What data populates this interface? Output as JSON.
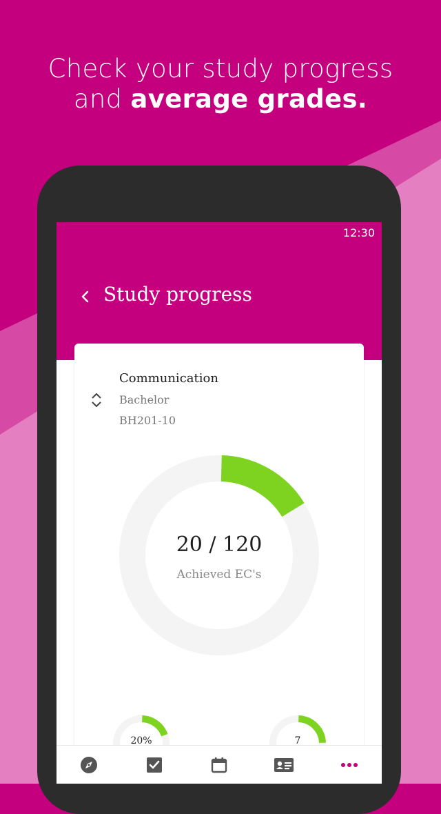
{
  "headline": {
    "line1": "Check your study progress",
    "line2_prefix": "and ",
    "line2_bold": "average grades."
  },
  "status_bar": {
    "time": "12:30"
  },
  "app_bar": {
    "title": "Study progress"
  },
  "program": {
    "name": "Communication",
    "level": "Bachelor",
    "code": "BH201-10"
  },
  "progress": {
    "value_text": "20 / 120",
    "label": "Achieved EC's",
    "fraction": 0.1667
  },
  "mini_stats": [
    {
      "text": "20%",
      "fraction": 0.2
    },
    {
      "text": "7",
      "fraction": 0.25
    }
  ],
  "bottom_nav": [
    {
      "icon": "compass-icon"
    },
    {
      "icon": "checkbox-icon"
    },
    {
      "icon": "calendar-icon"
    },
    {
      "icon": "id-card-icon"
    },
    {
      "icon": "more-dots-icon"
    }
  ],
  "colors": {
    "brand": "#c4007f",
    "progress": "#7ed321",
    "track": "#f4f4f4",
    "icon": "#555555"
  }
}
